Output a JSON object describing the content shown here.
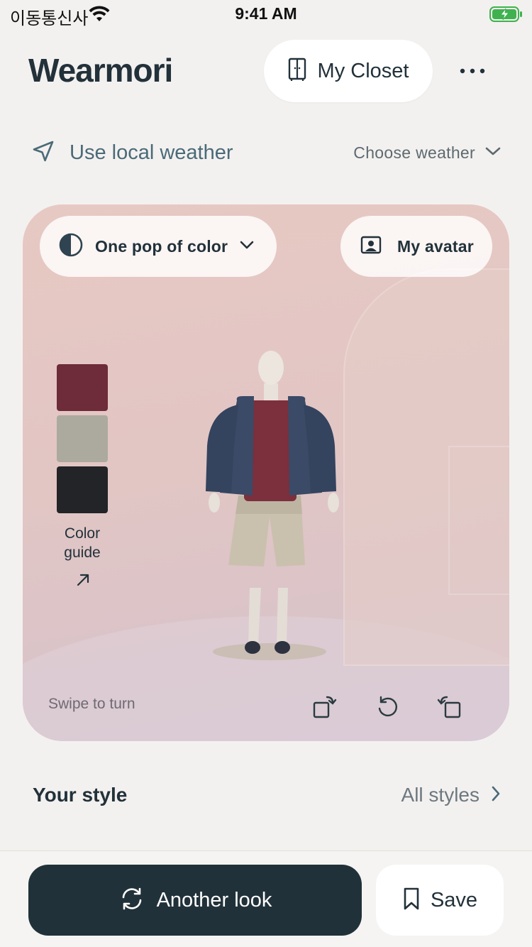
{
  "status_bar": {
    "carrier": "이동통신사",
    "time": "9:41 AM"
  },
  "header": {
    "brand": "Wearmori",
    "closet_label": "My Closet"
  },
  "weather": {
    "use_local_label": "Use local weather",
    "choose_label": "Choose weather"
  },
  "stage": {
    "style_select": "One pop of color",
    "avatar_label": "My avatar",
    "color_guide_label": "Color\nguide",
    "swatches": [
      "#6e2b39",
      "#acaa9f",
      "#232427"
    ],
    "swipe_hint": "Swipe to turn"
  },
  "style_section": {
    "title": "Your style",
    "link_label": "All styles"
  },
  "actions": {
    "another_look_label": "Another look",
    "save_label": "Save"
  }
}
